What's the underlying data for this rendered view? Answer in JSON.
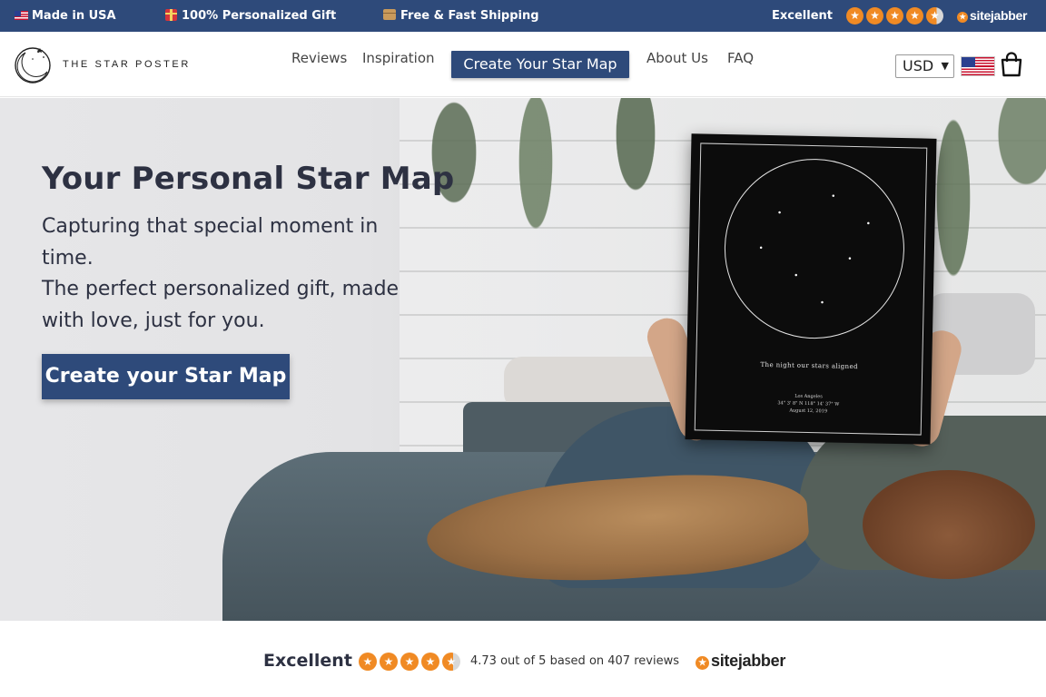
{
  "topbar": {
    "made_in": "Made in USA",
    "gift": "100% Personalized Gift",
    "shipping": "Free & Fast Shipping",
    "rating_word": "Excellent",
    "stars": 4.5,
    "brand": "sitejabber"
  },
  "header": {
    "logo_text": "THE STAR POSTER",
    "nav": [
      "Reviews",
      "Inspiration",
      "Create Your Star Map",
      "About Us",
      "FAQ"
    ],
    "currency": "USD"
  },
  "hero": {
    "title": "Your Personal Star Map",
    "subtitle_line1": "Capturing that special moment in time.",
    "subtitle_line2": "The perfect personalized gift, made with love, just for you.",
    "cta": "Create your Star Map",
    "poster": {
      "tagline": "The night our stars aligned",
      "location": "Los Angeles",
      "coords": "34° 3' 8\" N 118° 14' 37\" W",
      "date": "August 12, 2019"
    }
  },
  "reviews": {
    "label": "Excellent",
    "stars": 4.73,
    "summary": "4.73 out of 5 based on 407 reviews",
    "brand": "sitejabber"
  },
  "colors": {
    "primary": "#2e4a7a",
    "star": "#f08a24",
    "text": "#2d3142"
  }
}
